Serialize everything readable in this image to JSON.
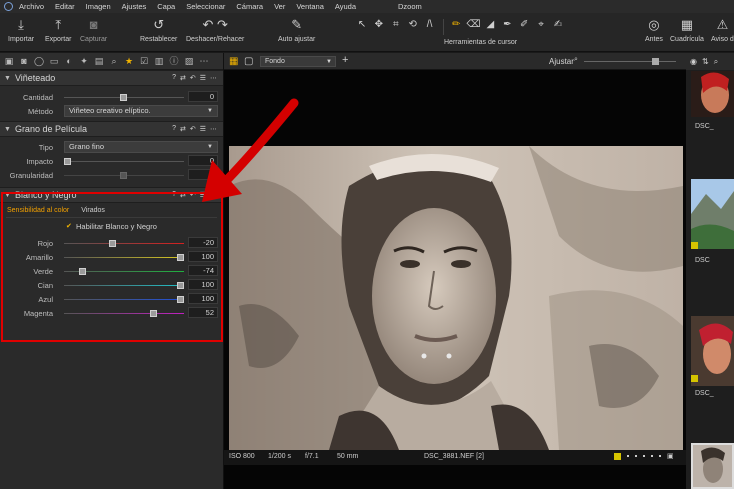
{
  "menu": {
    "items": [
      "Archivo",
      "Editar",
      "Imagen",
      "Ajustes",
      "Capa",
      "Seleccionar",
      "Cámara",
      "Ver",
      "Ventana",
      "Ayuda"
    ],
    "window_title": "Dzoom"
  },
  "toolbar": {
    "import_label": "Importar",
    "export_label": "Exportar",
    "capture_label": "Capturar",
    "reset_label": "Restablecer",
    "undo_redo_label": "Deshacer/Rehacer",
    "auto_adjust_label": "Auto ajustar",
    "cursor_tools_label": "Herramientas de cursor",
    "before_label": "Antes",
    "grid_label": "Cuadrícula",
    "warning_label": "Aviso d"
  },
  "vignette": {
    "title": "Viñeteado",
    "amount_label": "Cantidad",
    "amount_value": "0",
    "method_label": "Método",
    "method_value": "Viñeteo creativo elíptico."
  },
  "film_grain": {
    "title": "Grano de Película",
    "type_label": "Tipo",
    "type_value": "Grano fino",
    "impact_label": "Impacto",
    "impact_value": "0",
    "granularity_label": "Granularidad",
    "granularity_value": "..."
  },
  "black_white": {
    "title": "Blanco y Negro",
    "tab_sensitivity": "Sensibilidad al color",
    "tab_toning": "Virados",
    "enable_label": "Habilitar Blanco y Negro",
    "enabled": true,
    "sliders": [
      {
        "label": "Rojo",
        "value": "-20",
        "level": 0.4,
        "color": "#d42020"
      },
      {
        "label": "Amarillo",
        "value": "100",
        "level": 1.0,
        "color": "#d8c820"
      },
      {
        "label": "Verde",
        "value": "-74",
        "level": 0.13,
        "color": "#20b040"
      },
      {
        "label": "Cian",
        "value": "100",
        "level": 1.0,
        "color": "#20c0c8"
      },
      {
        "label": "Azul",
        "value": "100",
        "level": 1.0,
        "color": "#2050d8"
      },
      {
        "label": "Magenta",
        "value": "52",
        "level": 0.76,
        "color": "#c020c0"
      }
    ]
  },
  "viewer": {
    "style_select": "Fondo",
    "fit_label": "Ajustar",
    "zoom_level": 0.8,
    "iso": "ISO 800",
    "shutter": "1/200 s",
    "aperture": "f/7.1",
    "focal": "50 mm",
    "filename": "DSC_3881.NEF [2]"
  },
  "filmstrip": {
    "labels": [
      "DSC_",
      "DSC",
      "DSC_"
    ]
  },
  "colors": {
    "accent": "#f2b400",
    "highlight_border": "#e00000",
    "arrow": "#d40000"
  }
}
